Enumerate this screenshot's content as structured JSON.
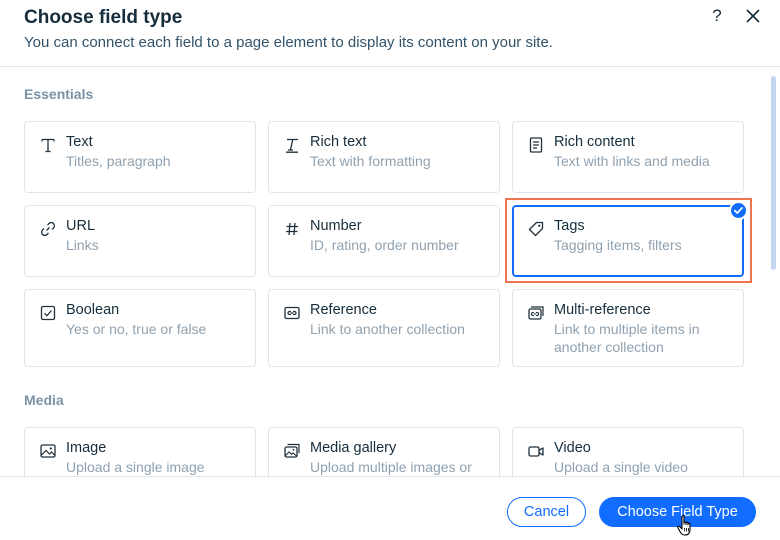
{
  "dialog": {
    "title": "Choose field type",
    "subtitle": "You can connect each field to a page element to display its content on your site.",
    "help_label": "?"
  },
  "sections": {
    "essentials": "Essentials",
    "media": "Media"
  },
  "cards": {
    "text": {
      "title": "Text",
      "desc": "Titles, paragraph",
      "icon": "text-icon"
    },
    "rich_text": {
      "title": "Rich text",
      "desc": "Text with formatting",
      "icon": "rich-text-icon"
    },
    "rich_content": {
      "title": "Rich content",
      "desc": "Text with links and media",
      "icon": "rich-content-icon"
    },
    "url": {
      "title": "URL",
      "desc": "Links",
      "icon": "link-icon"
    },
    "number": {
      "title": "Number",
      "desc": "ID, rating, order number",
      "icon": "hash-icon"
    },
    "tags": {
      "title": "Tags",
      "desc": "Tagging items, filters",
      "icon": "tag-icon",
      "selected": true
    },
    "boolean": {
      "title": "Boolean",
      "desc": "Yes or no, true or false",
      "icon": "checkbox-icon"
    },
    "reference": {
      "title": "Reference",
      "desc": "Link to another collection",
      "icon": "reference-icon"
    },
    "multi_reference": {
      "title": "Multi-reference",
      "desc": "Link to multiple items in another collection",
      "icon": "multi-reference-icon"
    },
    "image": {
      "title": "Image",
      "desc": "Upload a single image",
      "icon": "image-icon"
    },
    "media_gallery": {
      "title": "Media gallery",
      "desc": "Upload multiple images or",
      "icon": "gallery-icon"
    },
    "video": {
      "title": "Video",
      "desc": "Upload a single video",
      "icon": "video-icon"
    }
  },
  "footer": {
    "cancel_label": "Cancel",
    "confirm_label": "Choose Field Type"
  },
  "colors": {
    "accent": "#116dff",
    "highlight": "#f0734f",
    "title": "#162d3d",
    "secondary_text": "#8fa1b0",
    "border": "#dfe5eb"
  }
}
